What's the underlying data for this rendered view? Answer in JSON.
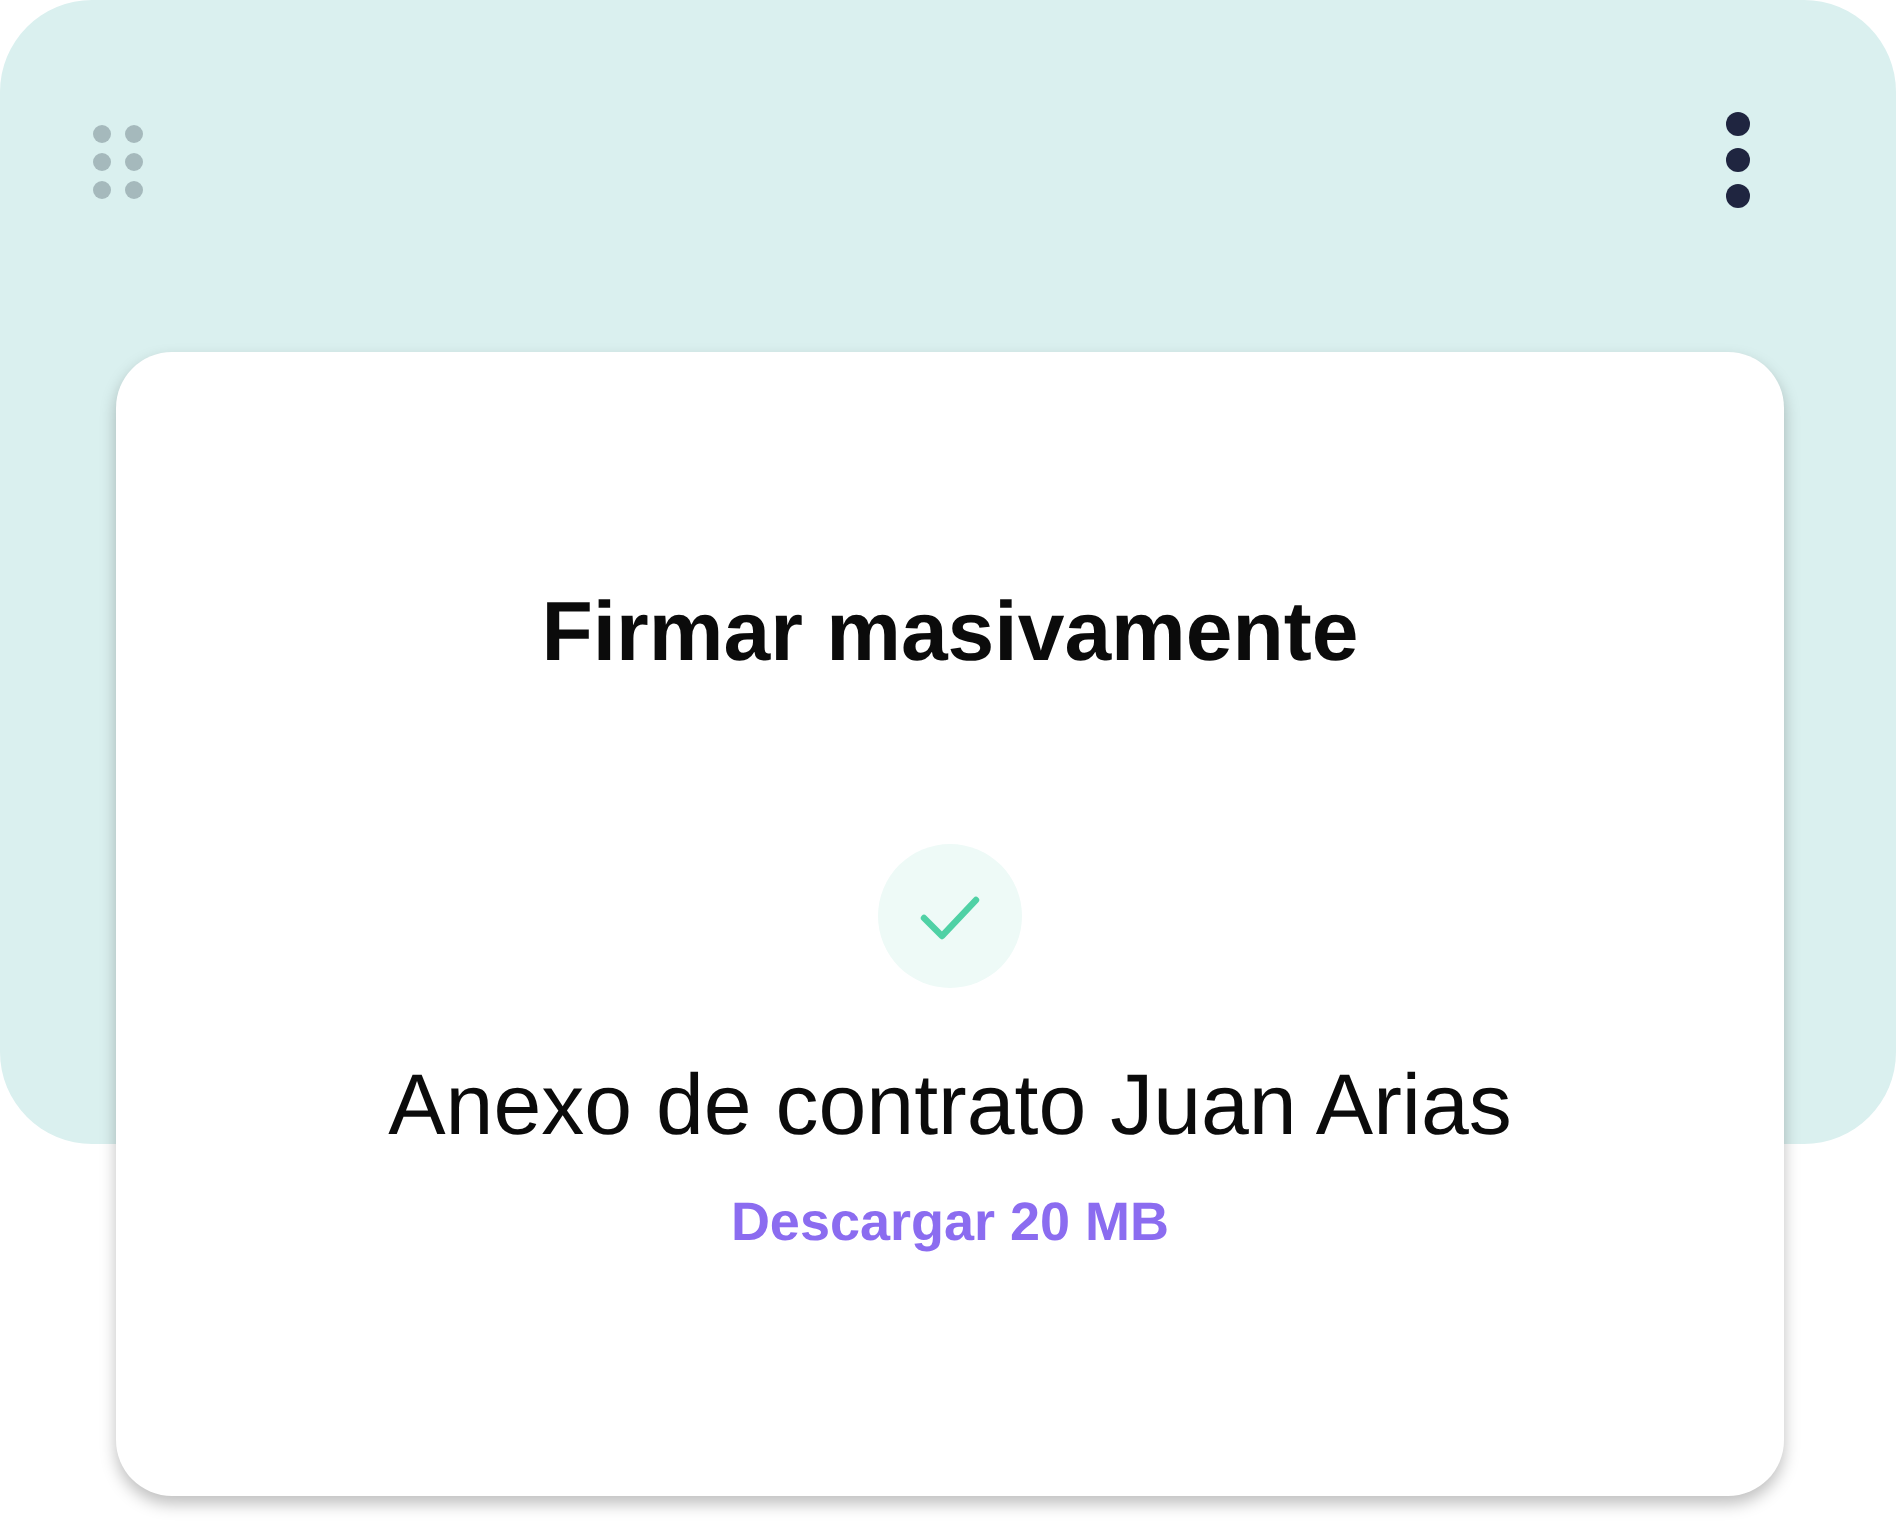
{
  "title": "Firmar masivamente",
  "file": {
    "name": "Anexo de contrato Juan Arias",
    "completed": true,
    "download_link": "Descargar 20 MB"
  }
}
